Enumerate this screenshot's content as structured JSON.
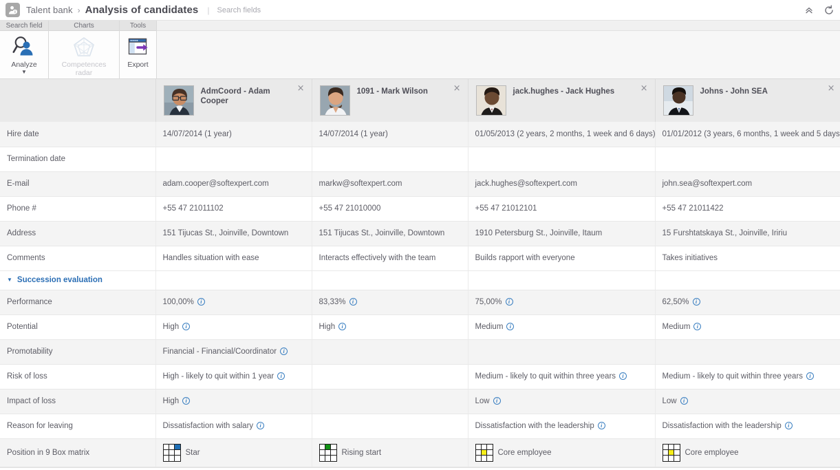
{
  "topbar": {
    "app_icon": "person-info-icon",
    "breadcrumb_root": "Talent bank",
    "breadcrumb_separator": "›",
    "breadcrumb_current": "Analysis of candidates",
    "divider": "|",
    "search_placeholder": "Search fields",
    "search_value": "",
    "actions": [
      {
        "name": "collapse-chevrons-icon",
        "glyph": "«"
      },
      {
        "name": "refresh-icon",
        "glyph": "↻"
      }
    ]
  },
  "ribbon": {
    "groups": [
      {
        "title": "Search field",
        "button_label": "Analyze",
        "icon": "analyze-magnifier-person-icon",
        "has_caret": true,
        "disabled": false
      },
      {
        "title": "Charts",
        "button_label": "Competences radar",
        "icon": "radar-chart-icon",
        "has_caret": false,
        "disabled": true
      },
      {
        "title": "Tools",
        "button_label": "Export",
        "icon": "export-window-arrow-icon",
        "has_caret": false,
        "disabled": false
      }
    ]
  },
  "grid": {
    "candidates": [
      {
        "title": "AdmCoord - Adam Cooper",
        "avatar": "photo-adam-cooper",
        "close_glyph": "×"
      },
      {
        "title": "1091 - Mark Wilson",
        "avatar": "photo-mark-wilson",
        "close_glyph": "×"
      },
      {
        "title": "jack.hughes - Jack Hughes",
        "avatar": "photo-jack-hughes",
        "close_glyph": "×"
      },
      {
        "title": "Johns - John SEA",
        "avatar": "photo-john-sea",
        "close_glyph": "×"
      }
    ],
    "rows": [
      {
        "type": "data",
        "label": "Hire date",
        "values": [
          {
            "text": "14/07/2014 (1 year)"
          },
          {
            "text": "14/07/2014 (1 year)"
          },
          {
            "text": "01/05/2013 (2 years, 2 months, 1 week and 6 days)"
          },
          {
            "text": "01/01/2012 (3 years, 6 months, 1 week and 5 days)"
          }
        ]
      },
      {
        "type": "data",
        "label": "Termination date",
        "values": [
          {
            "text": ""
          },
          {
            "text": ""
          },
          {
            "text": ""
          },
          {
            "text": ""
          }
        ]
      },
      {
        "type": "data",
        "label": "E-mail",
        "values": [
          {
            "text": "adam.cooper@softexpert.com"
          },
          {
            "text": "markw@softexpert.com"
          },
          {
            "text": "jack.hughes@softexpert.com"
          },
          {
            "text": "john.sea@softexpert.com"
          }
        ]
      },
      {
        "type": "data",
        "label": "Phone #",
        "values": [
          {
            "text": "+55 47 21011102"
          },
          {
            "text": "+55 47 21010000"
          },
          {
            "text": "+55 47 21012101"
          },
          {
            "text": "+55 47 21011422"
          }
        ]
      },
      {
        "type": "data",
        "label": "Address",
        "values": [
          {
            "text": "151 Tijucas St., Joinville, Downtown"
          },
          {
            "text": "151 Tijucas St., Joinville, Downtown"
          },
          {
            "text": "1910 Petersburg St., Joinville, Itaum"
          },
          {
            "text": "15 Furshtatskaya St., Joinville, Iririu"
          }
        ]
      },
      {
        "type": "data",
        "label": "Comments",
        "values": [
          {
            "text": "Handles situation with ease"
          },
          {
            "text": "Interacts effectively with the team"
          },
          {
            "text": "Builds rapport with everyone"
          },
          {
            "text": "Takes initiatives"
          }
        ]
      },
      {
        "type": "section",
        "label": "Succession evaluation",
        "caret": "▼",
        "expanded": true
      },
      {
        "type": "data",
        "label": "Performance",
        "values": [
          {
            "text": "100,00%",
            "info": true
          },
          {
            "text": "83,33%",
            "info": true
          },
          {
            "text": "75,00%",
            "info": true
          },
          {
            "text": "62,50%",
            "info": true
          }
        ]
      },
      {
        "type": "data",
        "label": "Potential",
        "values": [
          {
            "text": "High",
            "info": true
          },
          {
            "text": "High",
            "info": true
          },
          {
            "text": "Medium",
            "info": true
          },
          {
            "text": "Medium",
            "info": true
          }
        ]
      },
      {
        "type": "data",
        "label": "Promotability",
        "values": [
          {
            "text": "Financial - Financial/Coordinator",
            "info": true
          },
          {
            "text": ""
          },
          {
            "text": ""
          },
          {
            "text": ""
          }
        ]
      },
      {
        "type": "data",
        "label": "Risk of loss",
        "values": [
          {
            "text": "High - likely to quit within 1 year",
            "info": true
          },
          {
            "text": ""
          },
          {
            "text": "Medium - likely to quit within three years",
            "info": true
          },
          {
            "text": "Medium - likely to quit within three years",
            "info": true
          }
        ]
      },
      {
        "type": "data",
        "label": "Impact of loss",
        "values": [
          {
            "text": "High",
            "info": true
          },
          {
            "text": ""
          },
          {
            "text": "Low",
            "info": true
          },
          {
            "text": "Low",
            "info": true
          }
        ]
      },
      {
        "type": "data",
        "label": "Reason for leaving",
        "values": [
          {
            "text": "Dissatisfaction with salary",
            "info": true
          },
          {
            "text": ""
          },
          {
            "text": "Dissatisfaction with the leadership",
            "info": true
          },
          {
            "text": "Dissatisfaction with the leadership",
            "info": true
          }
        ]
      },
      {
        "type": "ninebox",
        "label": "Position in 9 Box matrix",
        "values": [
          {
            "text": "Star",
            "cell": 2,
            "color": "#1f6fb5"
          },
          {
            "text": "Rising start",
            "cell": 1,
            "color": "#0f9113"
          },
          {
            "text": "Core employee",
            "cell": 4,
            "color": "#f6ee1a"
          },
          {
            "text": "Core employee",
            "cell": 4,
            "color": "#f6ee1a"
          }
        ]
      }
    ]
  },
  "colors": {
    "accent_blue": "#2c6fb5",
    "info_blue": "#3a7fc1",
    "star_blue": "#1f6fb5",
    "rising_green": "#0f9113",
    "core_yellow": "#f6ee1a",
    "header_grey": "#eaeaea",
    "row_alt_grey": "#f4f4f4"
  }
}
